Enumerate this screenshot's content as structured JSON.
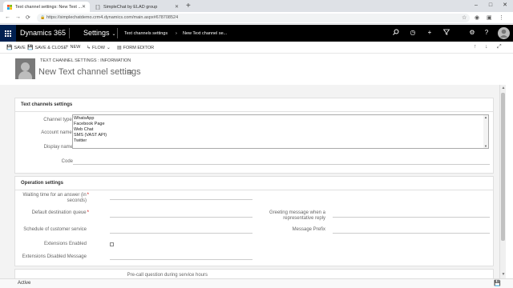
{
  "browser": {
    "tabs": [
      {
        "title": "Text channel settings: New Text ..."
      },
      {
        "title": "SimpleChat by ELAD group"
      }
    ],
    "url": "https://simplechatdemo.crm4.dynamics.com/main.aspx#678708524",
    "new_tab": "+",
    "win_minimize": "–",
    "win_maximize": "□",
    "win_close": "✕"
  },
  "nav": {
    "brand": "Dynamics 365",
    "area": "Settings",
    "breadcrumb1": "Text channels settings",
    "breadcrumb2": "New Text channel se..."
  },
  "commands": {
    "save": "SAVE",
    "save_close": "SAVE & CLOSE",
    "new": "NEW",
    "flow": "FLOW",
    "form_editor": "FORM EDITOR"
  },
  "header": {
    "entity": "TEXT CHANNEL SETTINGS : INFORMATION",
    "title": "New Text channel settings"
  },
  "sections": {
    "text_channels": {
      "title": "Text channels settings",
      "channel_type_label": "Channel type",
      "account_name_label": "Account name",
      "display_name_label": "Display name",
      "code_label": "Code",
      "options": [
        "WhatsApp",
        "Facebook Page",
        "Web Chat",
        "SMS (VAST API)",
        "Twitter"
      ]
    },
    "operation": {
      "title": "Operation settings",
      "waiting_time_label_1": "Waiting time for an answer (in",
      "waiting_time_label_2": "seconds)",
      "default_queue_label": "Default destination queue",
      "schedule_label": "Schedule of customer service",
      "extensions_enabled_label": "Extensions Enabled",
      "extensions_disabled_label": "Extensions Disabled Message",
      "greeting_label_1": "Greeting message when a",
      "greeting_label_2": "representative reply",
      "message_prefix_label": "Message Prefix"
    },
    "pre_call": {
      "label": "Pre-call question during service hours"
    }
  },
  "status": {
    "state": "Active"
  }
}
